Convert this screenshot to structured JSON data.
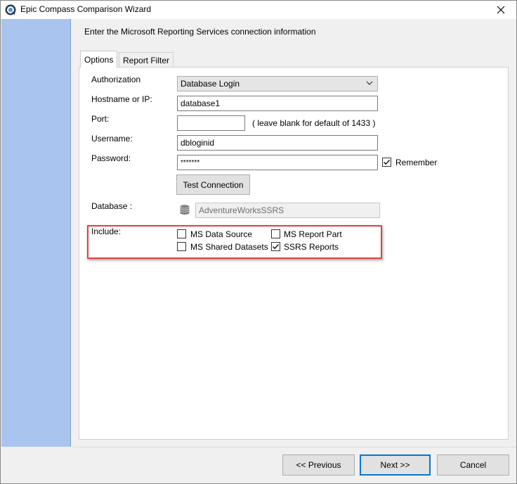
{
  "window": {
    "title": "Epic Compass Comparison Wizard",
    "app_icon": "compass-logo-icon",
    "close_icon": "close-icon"
  },
  "heading": "Enter the Microsoft Reporting Services connection information",
  "tabs": [
    {
      "label": "Options",
      "active": true
    },
    {
      "label": "Report Filter",
      "active": false
    }
  ],
  "form": {
    "authorization": {
      "label": "Authorization",
      "value": "Database Login"
    },
    "hostname": {
      "label": "Hostname or IP:",
      "value": "database1"
    },
    "port": {
      "label": "Port:",
      "value": "",
      "hint": "( leave blank for default of 1433 )"
    },
    "username": {
      "label": "Username:",
      "value": "dbloginid"
    },
    "password": {
      "label": "Password:",
      "value": "*******"
    },
    "remember": {
      "label": "Remember",
      "checked": true
    },
    "test_connection": "Test Connection",
    "database": {
      "label": "Database :",
      "value": "AdventureWorksSSRS",
      "icon": "database-icon"
    }
  },
  "include": {
    "label": "Include:",
    "options": [
      {
        "label": "MS Data Source",
        "checked": false
      },
      {
        "label": "MS Report Part",
        "checked": false
      },
      {
        "label": "MS Shared Datasets",
        "checked": false
      },
      {
        "label": "SSRS Reports",
        "checked": true
      }
    ],
    "highlight_color": "#e0413f"
  },
  "footer": {
    "previous": "<< Previous",
    "next": "Next >>",
    "cancel": "Cancel"
  },
  "colors": {
    "sidebar": "#a9c4ef",
    "accent": "#0078d7"
  }
}
